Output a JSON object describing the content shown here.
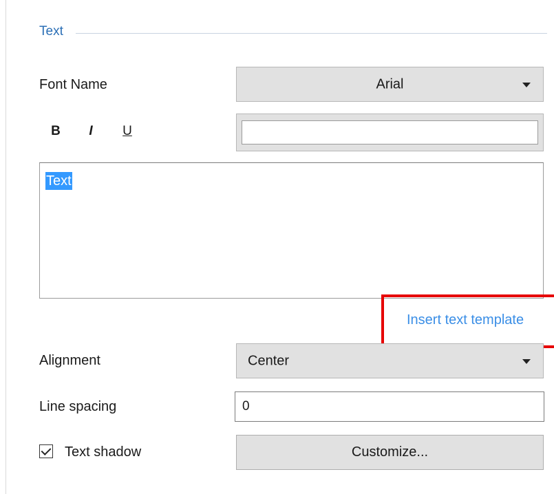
{
  "group": {
    "title": "Text"
  },
  "font": {
    "label": "Font Name",
    "value": "Arial"
  },
  "format": {
    "bold": "B",
    "italic": "I",
    "underline": "U"
  },
  "text_content": {
    "selected_text": "Text"
  },
  "template_link": {
    "label": "Insert text template",
    "highlight_color": "#e60000"
  },
  "alignment": {
    "label": "Alignment",
    "value": "Center"
  },
  "line_spacing": {
    "label": "Line spacing",
    "value": "0"
  },
  "text_shadow": {
    "label": "Text shadow",
    "checked": true,
    "customize_label": "Customize..."
  },
  "colors": {
    "accent": "#2b6fb6",
    "link": "#3a8ee6",
    "selection": "#3399ff"
  }
}
